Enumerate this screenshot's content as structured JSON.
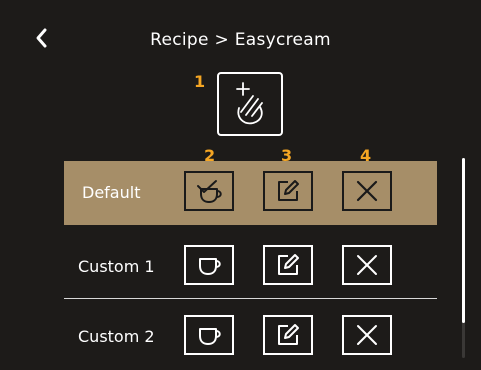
{
  "header": {
    "title": "Recipe > Easycream",
    "back_icon": "chevron-left-icon"
  },
  "add_button": {
    "icon": "add-cream-icon",
    "callout": "1"
  },
  "column_callouts": {
    "select": "2",
    "edit": "3",
    "delete": "4"
  },
  "recipes": [
    {
      "label": "Default",
      "selected": true
    },
    {
      "label": "Custom 1",
      "selected": false
    },
    {
      "label": "Custom 2",
      "selected": false
    }
  ],
  "colors": {
    "background": "#1d1b19",
    "selected_row": "#a68e68",
    "callout": "#f5a623",
    "foreground": "#ffffff"
  }
}
